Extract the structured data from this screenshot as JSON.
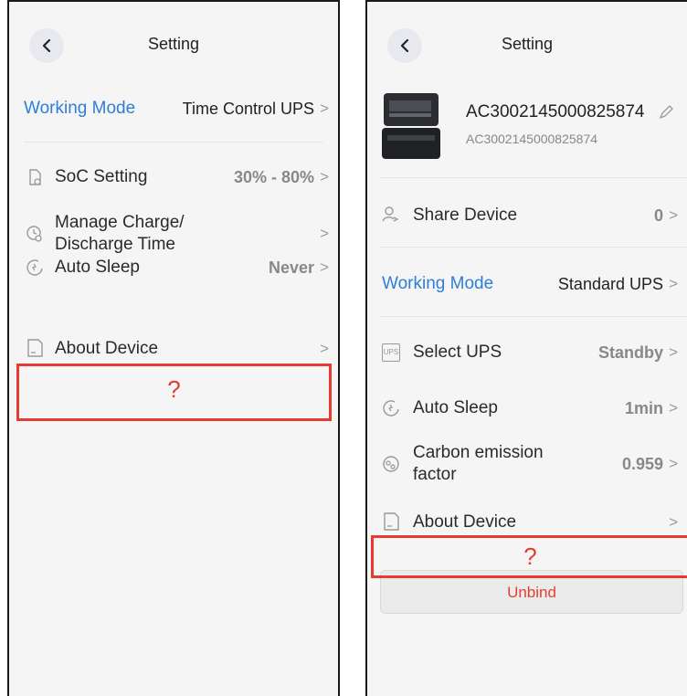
{
  "left": {
    "title": "Setting",
    "working_mode_label": "Working Mode",
    "working_mode_value": "Time Control UPS",
    "items": [
      {
        "label": "SoC Setting",
        "value": "30% - 80%"
      },
      {
        "label_line1": "Manage Charge/",
        "label_line2": "Discharge Time"
      },
      {
        "label": "Auto Sleep",
        "value": "Never"
      },
      {
        "label": "About Device"
      }
    ],
    "placeholder": "?"
  },
  "right": {
    "title": "Setting",
    "device_name": "AC3002145000825874",
    "device_serial": "AC3002145000825874",
    "share_label": "Share Device",
    "share_value": "0",
    "working_mode_label": "Working Mode",
    "working_mode_value": "Standard UPS",
    "items": [
      {
        "label": "Select UPS",
        "value": "Standby",
        "icon_text": "UPS"
      },
      {
        "label": "Auto Sleep",
        "value": "1min"
      },
      {
        "label_line1": "Carbon emission",
        "label_line2": "factor",
        "value": "0.959"
      },
      {
        "label": "About Device"
      }
    ],
    "placeholder": "?",
    "unbind_label": "Unbind"
  },
  "colors": {
    "accent": "#2e7fd6",
    "alert": "#e83a33",
    "background": "#f5f5f5"
  },
  "icons": [
    "chevron-left-icon",
    "chevron-right-icon",
    "soc-icon",
    "clock-icon",
    "sleep-icon",
    "document-icon",
    "user-share-icon",
    "ups-icon",
    "carbon-icon",
    "edit-icon"
  ]
}
